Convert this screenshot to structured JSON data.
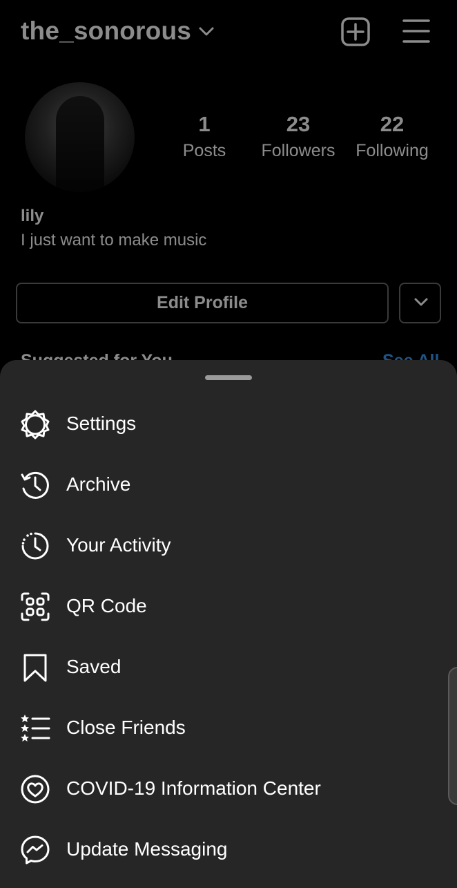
{
  "profile": {
    "username": "the_sonorous",
    "name": "lily",
    "bio": "I just want to make music",
    "stats": {
      "posts": {
        "value": "1",
        "label": "Posts"
      },
      "followers": {
        "value": "23",
        "label": "Followers"
      },
      "following": {
        "value": "22",
        "label": "Following"
      }
    },
    "edit_label": "Edit Profile",
    "suggested_label": "Suggested for You",
    "see_all_label": "See All"
  },
  "menu": {
    "items": [
      {
        "label": "Settings",
        "icon": "settings-icon"
      },
      {
        "label": "Archive",
        "icon": "archive-icon"
      },
      {
        "label": "Your Activity",
        "icon": "activity-icon"
      },
      {
        "label": "QR Code",
        "icon": "qr-code-icon"
      },
      {
        "label": "Saved",
        "icon": "bookmark-icon"
      },
      {
        "label": "Close Friends",
        "icon": "close-friends-icon"
      },
      {
        "label": "COVID-19 Information Center",
        "icon": "covid-heart-icon"
      },
      {
        "label": "Update Messaging",
        "icon": "messenger-icon"
      }
    ]
  },
  "colors": {
    "background": "#000000",
    "sheet": "#262626",
    "link": "#3897f0"
  }
}
